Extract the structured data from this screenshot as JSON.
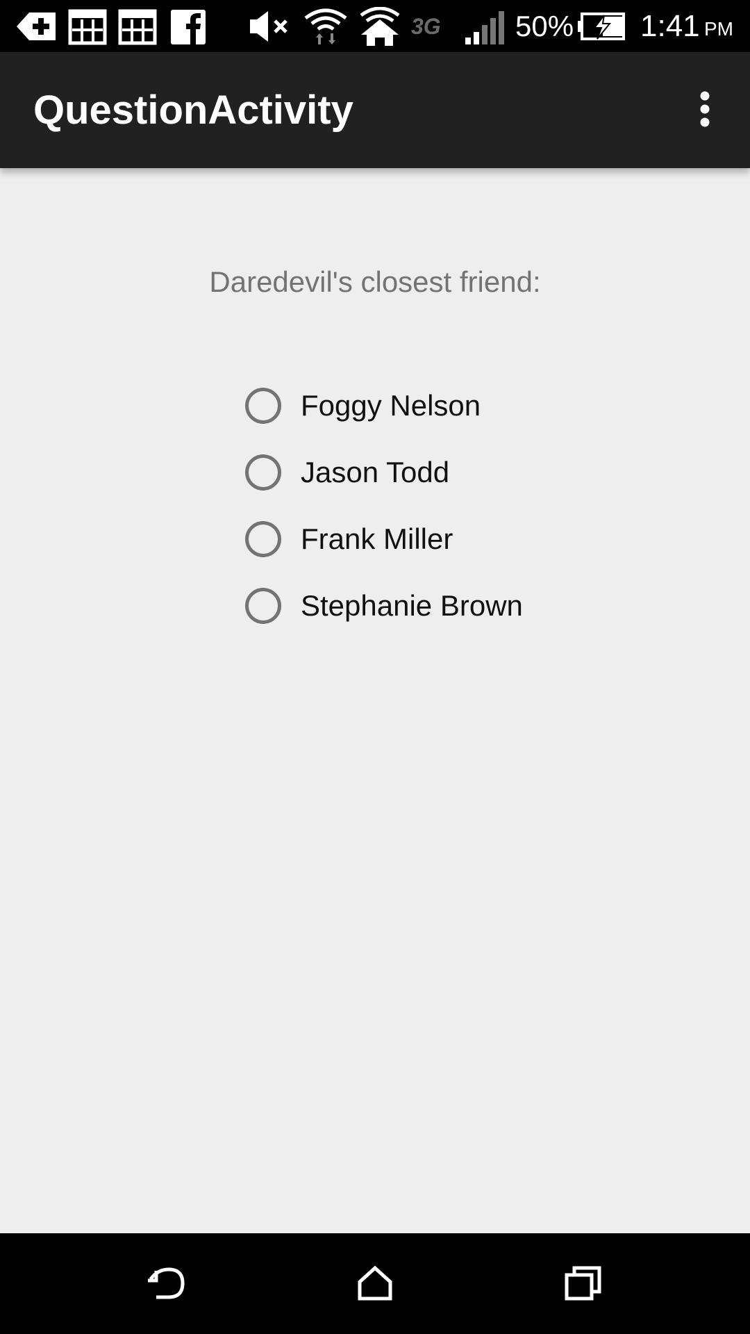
{
  "status_bar": {
    "icons": [
      "add-notification-icon",
      "calendar-icon",
      "calendar-icon",
      "facebook-icon",
      "mute-icon",
      "wifi-icon",
      "home-wifi-icon",
      "network-3g-icon",
      "signal-icon",
      "battery-charging-icon"
    ],
    "network_type": "3G",
    "battery": "50%",
    "time": "1:41",
    "ampm": "PM"
  },
  "app_bar": {
    "title": "QuestionActivity",
    "menu_icon": "more-vert-icon"
  },
  "question": {
    "text": "Daredevil's closest friend:",
    "options": [
      {
        "label": "Foggy Nelson",
        "selected": false
      },
      {
        "label": "Jason Todd",
        "selected": false
      },
      {
        "label": "Frank Miller",
        "selected": false
      },
      {
        "label": "Stephanie Brown",
        "selected": false
      }
    ]
  },
  "nav_bar": {
    "icons": [
      "back-icon",
      "home-icon",
      "recents-icon"
    ]
  },
  "colors": {
    "status_bar": "#000000",
    "app_bar": "#212121",
    "background": "#eeeeee",
    "question_text": "#737373",
    "radio_outline": "#737373",
    "option_text": "#111111",
    "nav_bar": "#000000"
  }
}
